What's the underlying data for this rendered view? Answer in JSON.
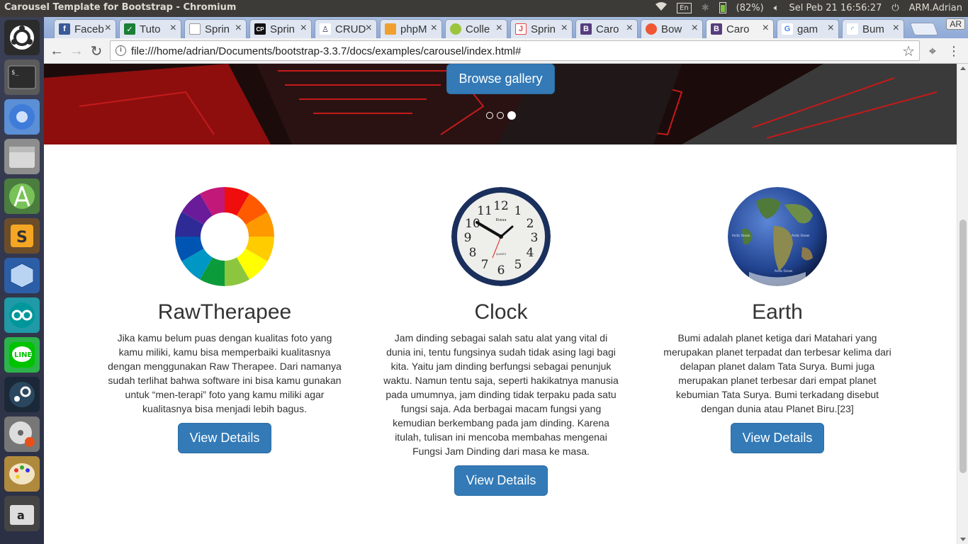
{
  "window": {
    "title": "Carousel Template for Bootstrap - Chromium"
  },
  "system_tray": {
    "keyboard": "En",
    "battery": "(82%)",
    "datetime": "Sel Peb 21 16:56:27",
    "user": "ARM.Adrian"
  },
  "launcher": {
    "items": [
      "ubuntu-dash",
      "terminal",
      "chromium",
      "files",
      "android-studio",
      "sublime-text",
      "virtualbox",
      "arduino",
      "line",
      "steam",
      "brasero",
      "paint",
      "amazon"
    ]
  },
  "tabs": [
    {
      "label": "Faceb",
      "favicon": "f",
      "color": "#3b5998"
    },
    {
      "label": "Tuto",
      "favicon": "✓",
      "color": "#1a7f37"
    },
    {
      "label": "Sprin",
      "favicon": "",
      "color": "#ffffff"
    },
    {
      "label": "Sprin",
      "favicon": "CP",
      "color": "#111111"
    },
    {
      "label": "CRUD",
      "favicon": "",
      "color": "#ffffff"
    },
    {
      "label": "phpM",
      "favicon": "",
      "color": "#f0a030"
    },
    {
      "label": "Colle",
      "favicon": "",
      "color": "#9bc53d"
    },
    {
      "label": "Sprin",
      "favicon": "J",
      "color": "#ffffff"
    },
    {
      "label": "Caro",
      "favicon": "B",
      "color": "#563d7c"
    },
    {
      "label": "Bow",
      "favicon": "",
      "color": "#ef5734"
    },
    {
      "label": "Caro",
      "favicon": "B",
      "color": "#563d7c",
      "active": true
    },
    {
      "label": "gam",
      "favicon": "G",
      "color": "#ffffff"
    },
    {
      "label": "Bum",
      "favicon": "",
      "color": "#ffffff"
    }
  ],
  "toolbar": {
    "url": "file:///home/adrian/Documents/bootstrap-3.3.7/docs/examples/carousel/index.html#",
    "ar_label": "AR"
  },
  "carousel": {
    "button_label": "Browse gallery",
    "active_index": 2,
    "slide_count": 3
  },
  "columns": [
    {
      "title": "RawTherapee",
      "text": "Jika kamu belum puas dengan kualitas foto yang kamu miliki, kamu bisa memperbaiki kualitasnya dengan menggunakan Raw Therapee. Dari namanya sudah terlihat bahwa software ini bisa kamu gunakan untuk “men-terapi” foto yang kamu miliki agar kualitasnya bisa menjadi lebih bagus.",
      "button": "View Details"
    },
    {
      "title": "Clock",
      "text": "Jam dinding sebagai salah satu alat yang vital di dunia ini, tentu fungsinya sudah tidak asing lagi bagi kita. Yaitu jam dinding berfungsi sebagai penunjuk waktu. Namun tentu saja, seperti hakikatnya manusia pada umumnya, jam dinding tidak terpaku pada satu fungsi saja. Ada berbagai macam fungsi yang kemudian berkembang pada jam dinding. Karena itulah, tulisan ini mencoba membahas mengenai Fungsi Jam Dinding dari masa ke masa.",
      "button": "View Details",
      "clock_brand": "Riwaa",
      "clock_sub": "QUARTZ"
    },
    {
      "title": "Earth",
      "text": "Bumi adalah planet ketiga dari Matahari yang merupakan planet terpadat dan terbesar kelima dari delapan planet dalam Tata Surya. Bumi juga merupakan planet terbesar dari empat planet kebumian Tata Surya. Bumi terkadang disebut dengan dunia atau Planet Biru.[23]",
      "button": "View Details",
      "globe_labels": [
        "Arctic Ocean",
        "Arctic Ocean",
        "Arctic Ocean"
      ]
    }
  ],
  "colors": {
    "primary": "#337ab7",
    "ubuntu_panel": "#3c3b37"
  }
}
